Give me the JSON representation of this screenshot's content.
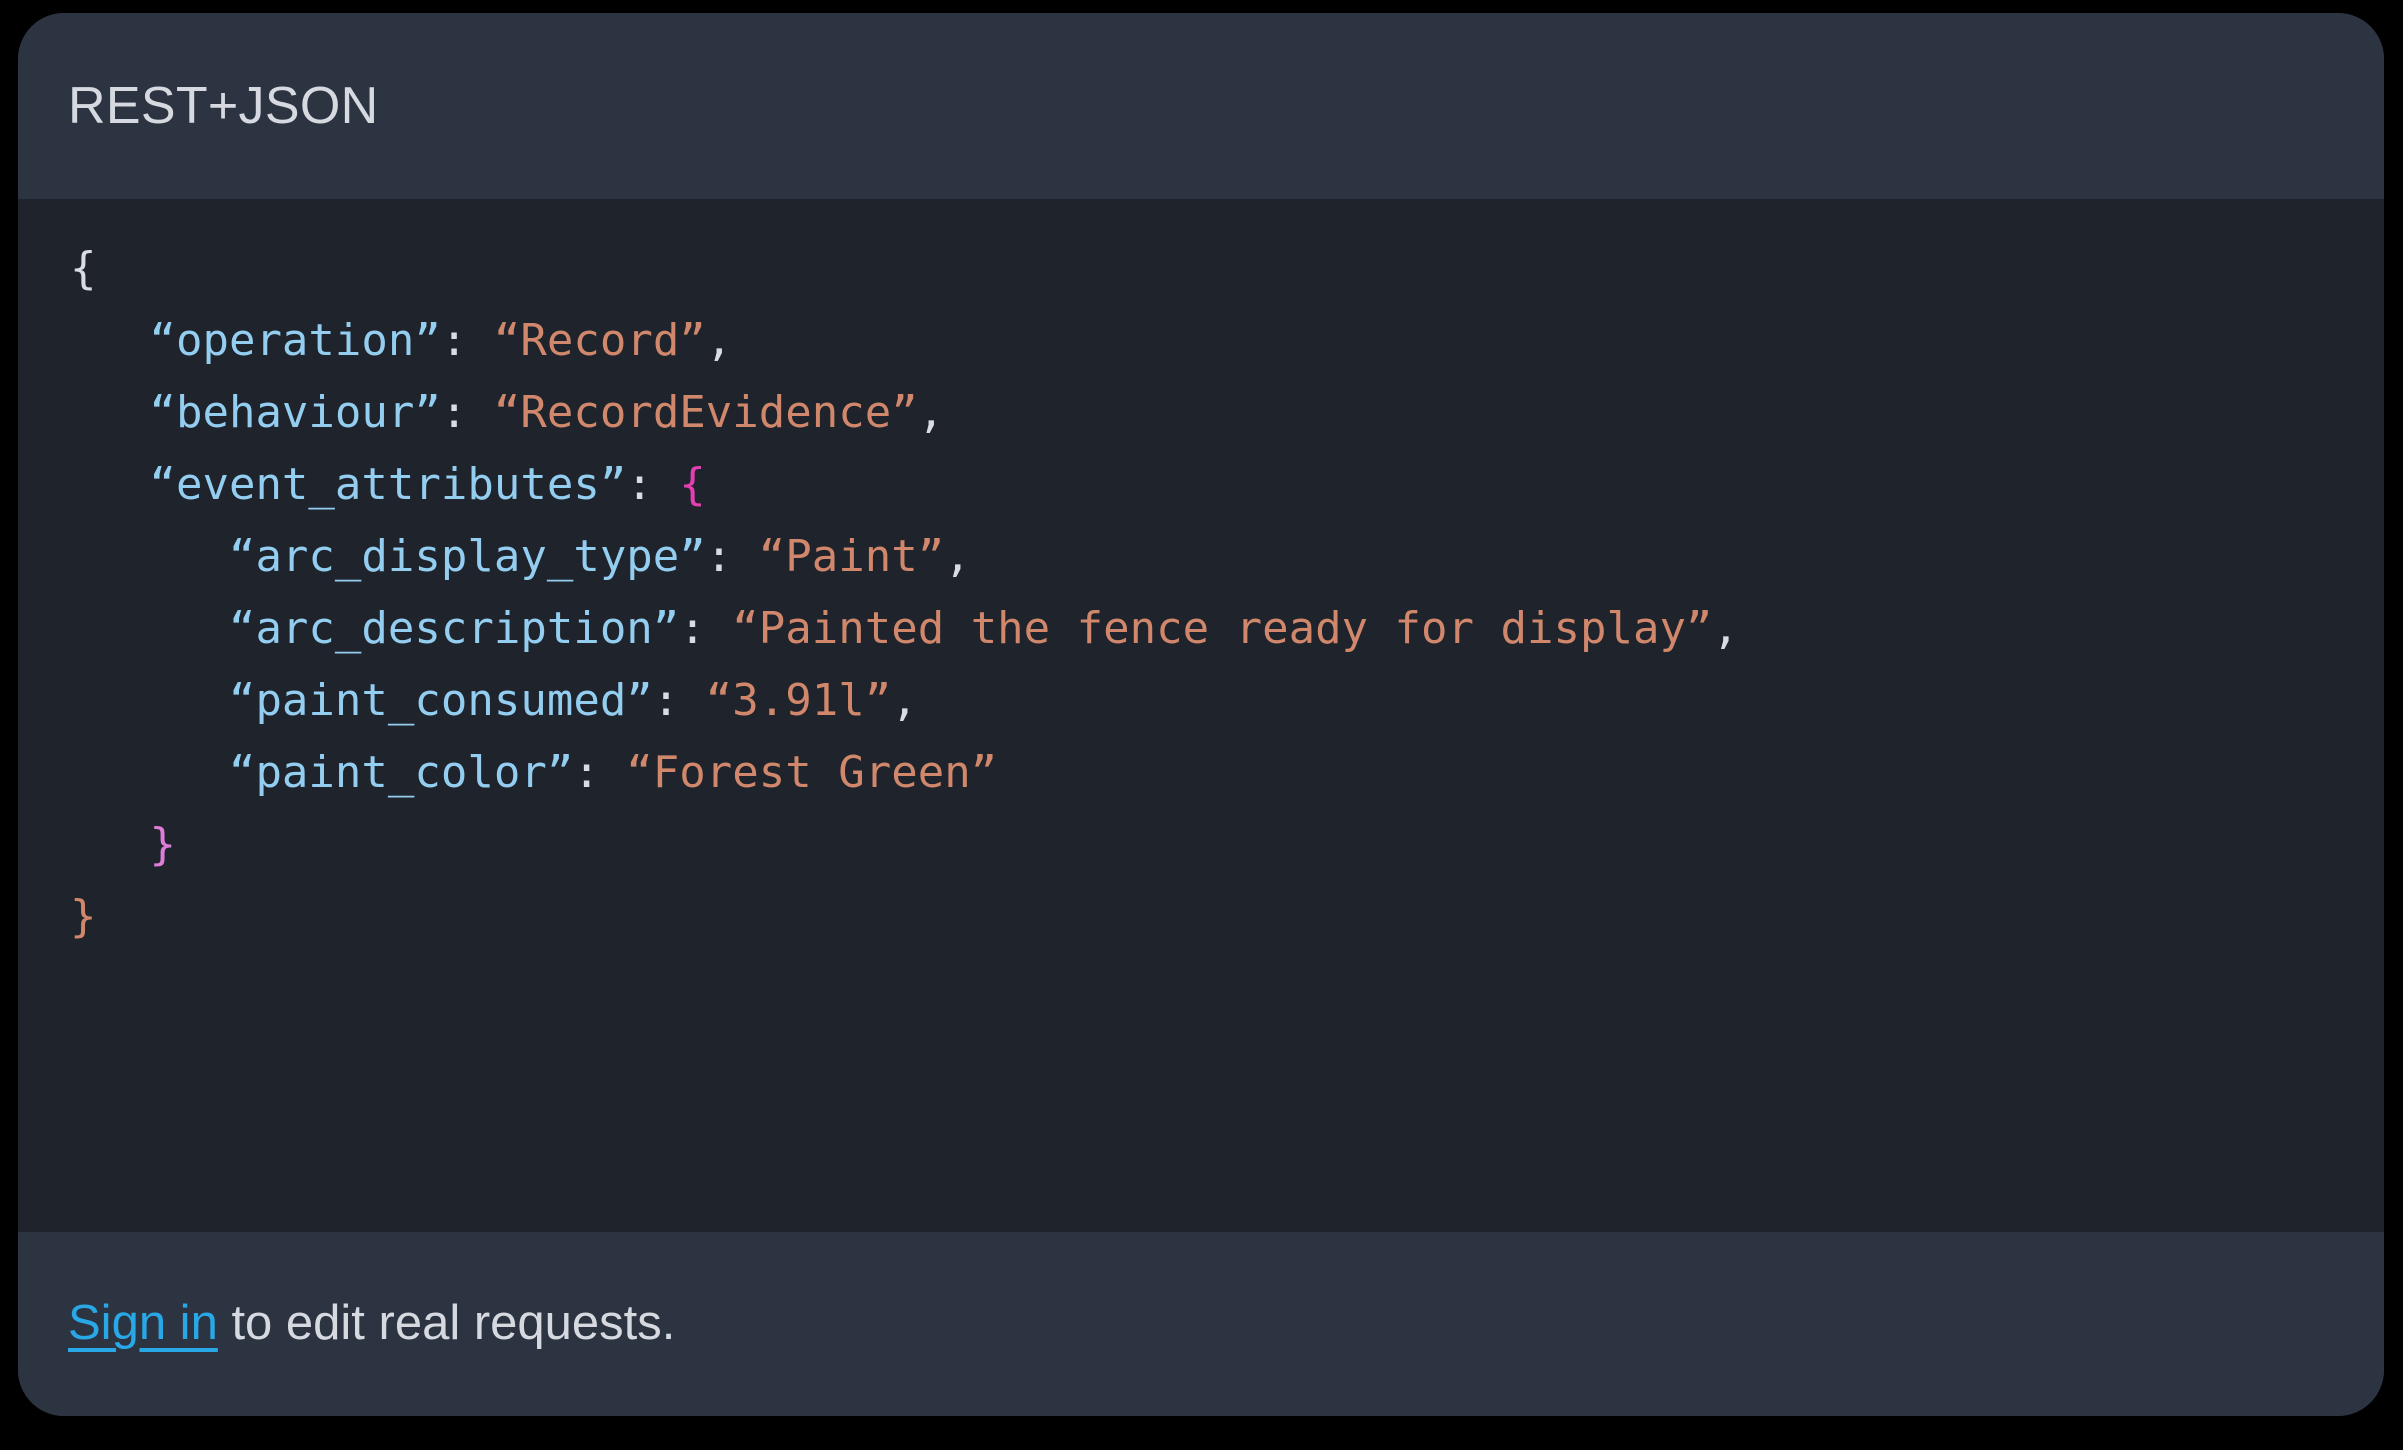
{
  "page": {
    "background_color": "#000000"
  },
  "card": {
    "background_color": "#2d3441",
    "code_background_color": "#1f232b"
  },
  "header": {
    "title": "REST+JSON"
  },
  "code": {
    "language": "json",
    "colors": {
      "key": "#93cdf0",
      "string": "#d0876b",
      "punctuation": "#d9dde3",
      "brace_nested_open": "#e23fb0",
      "brace_nested_close": "#dd7dd9",
      "brace_outer_close": "#d0876b"
    },
    "lines": [
      {
        "indent": 0,
        "segments": [
          {
            "text": "{",
            "type": "brace-outer-open"
          }
        ]
      },
      {
        "indent": 1,
        "segments": [
          {
            "text": "“operation”",
            "type": "key"
          },
          {
            "text": ": ",
            "type": "punct"
          },
          {
            "text": "“Record”",
            "type": "string"
          },
          {
            "text": ",",
            "type": "punct"
          }
        ]
      },
      {
        "indent": 1,
        "segments": [
          {
            "text": "“behaviour”",
            "type": "key"
          },
          {
            "text": ": ",
            "type": "punct"
          },
          {
            "text": "“RecordEvidence”",
            "type": "string"
          },
          {
            "text": ",",
            "type": "punct"
          }
        ]
      },
      {
        "indent": 1,
        "segments": [
          {
            "text": "“event_attributes”",
            "type": "key"
          },
          {
            "text": ": ",
            "type": "punct"
          },
          {
            "text": "{",
            "type": "brace-nested-open"
          }
        ]
      },
      {
        "indent": 2,
        "segments": [
          {
            "text": "“arc_display_type”",
            "type": "key"
          },
          {
            "text": ": ",
            "type": "punct"
          },
          {
            "text": "“Paint”",
            "type": "string"
          },
          {
            "text": ",",
            "type": "punct"
          }
        ]
      },
      {
        "indent": 2,
        "segments": [
          {
            "text": "“arc_description”",
            "type": "key"
          },
          {
            "text": ": ",
            "type": "punct"
          },
          {
            "text": "“Painted the fence ready for display”",
            "type": "string"
          },
          {
            "text": ",",
            "type": "punct"
          }
        ]
      },
      {
        "indent": 2,
        "segments": [
          {
            "text": "“paint_consumed”",
            "type": "key"
          },
          {
            "text": ": ",
            "type": "punct"
          },
          {
            "text": "“3.91l”",
            "type": "string"
          },
          {
            "text": ",",
            "type": "punct"
          }
        ]
      },
      {
        "indent": 2,
        "segments": [
          {
            "text": "“paint_color”",
            "type": "key"
          },
          {
            "text": ": ",
            "type": "punct"
          },
          {
            "text": "“Forest Green”",
            "type": "string"
          }
        ]
      },
      {
        "indent": 1,
        "segments": [
          {
            "text": "}",
            "type": "brace-nested-close"
          }
        ]
      },
      {
        "indent": 0,
        "segments": [
          {
            "text": "}",
            "type": "brace-outer-close"
          }
        ]
      }
    ]
  },
  "footer": {
    "link_label": "Sign in",
    "link_color": "#29a8e8",
    "rest_text": " to edit real requests."
  }
}
